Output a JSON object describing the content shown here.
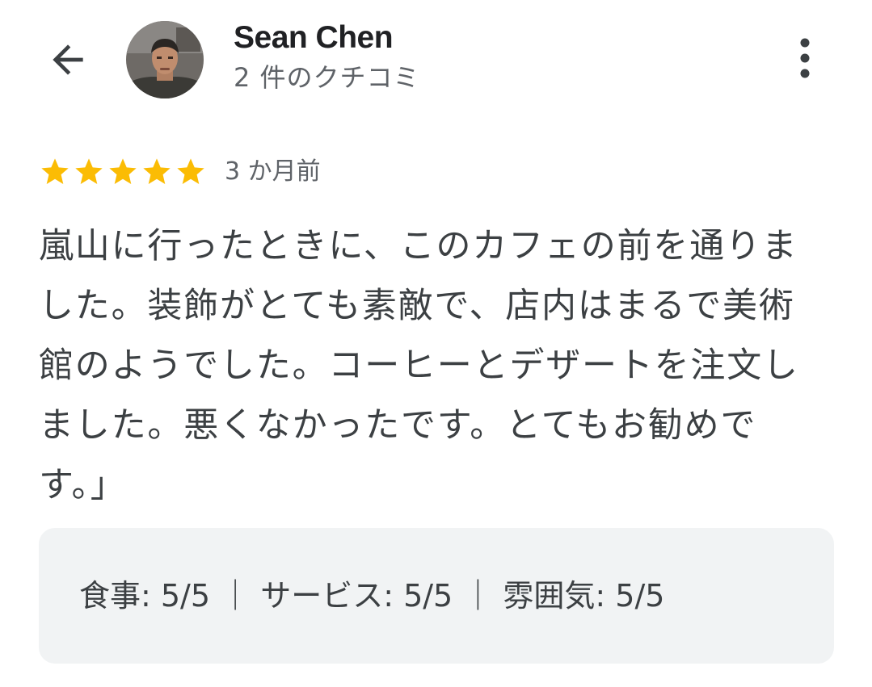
{
  "header": {
    "back_icon": "arrow-back-icon",
    "author_name": "Sean Chen",
    "review_count": "2 件のクチコミ",
    "more_icon": "more-vert-icon"
  },
  "review": {
    "rating": 5,
    "max_rating": 5,
    "star_color": "#fbbc04",
    "time": "3 か月前",
    "text": "嵐山に行ったときに、このカフェの前を通りました。装飾がとても素敵で、店内はまるで美術館のようでした。コーヒーとデザートを注文しました。悪くなかったです。とてもお勧めです。」"
  },
  "attributes": {
    "text": "食事: 5/5 ｜ サービス: 5/5 ｜ 雰囲気: 5/5"
  }
}
